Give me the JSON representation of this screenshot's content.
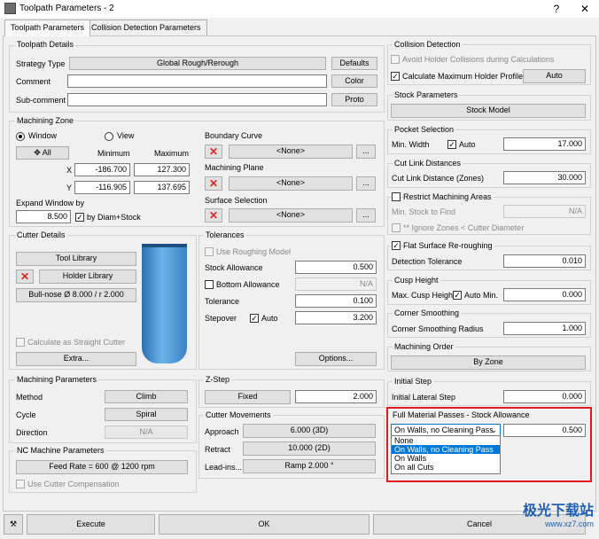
{
  "window": {
    "title": "Toolpath Parameters - 2",
    "help_label": "?",
    "close_label": "✕"
  },
  "tabs": [
    "Toolpath Parameters",
    "Collision Detection Parameters"
  ],
  "toolpath_details": {
    "group_title": "Toolpath Details",
    "strategy_type_label": "Strategy Type",
    "strategy_type_value": "Global Rough/Rerough",
    "defaults_label": "Defaults",
    "comment_label": "Comment",
    "comment_value": "",
    "color_label": "Color",
    "subcomment_label": "Sub-comment",
    "subcomment_value": "",
    "proto_label": "Proto"
  },
  "machining_zone": {
    "group_title": "Machining Zone",
    "window_label": "Window",
    "view_label": "View",
    "all_label": "All",
    "minimum_label": "Minimum",
    "maximum_label": "Maximum",
    "x_label": "X",
    "y_label": "Y",
    "x_min": "-186.700",
    "x_max": "127.300",
    "y_min": "-116.905",
    "y_max": "137.695",
    "expand_label": "Expand Window by",
    "expand_value": "8.500",
    "diam_stock_label": "by Diam+Stock",
    "boundary_label": "Boundary Curve",
    "boundary_value": "<None>",
    "plane_label": "Machining Plane",
    "plane_value": "<None>",
    "surface_label": "Surface Selection",
    "surface_value": "<None>",
    "ellipsis": "..."
  },
  "cutter_details": {
    "group_title": "Cutter Details",
    "tool_library_label": "Tool Library",
    "holder_library_label": "Holder Library",
    "tool_name": "Bull-nose Ø 8.000 / r 2.000",
    "straight_cutter_label": "Calculate as Straight Cutter",
    "extra_label": "Extra..."
  },
  "tolerances": {
    "group_title": "Tolerances",
    "roughing_model_label": "Use Roughing Model",
    "stock_allowance_label": "Stock Allowance",
    "stock_allowance_value": "0.500",
    "bottom_allowance_label": "Bottom Allowance",
    "bottom_allowance_value": "N/A",
    "tolerance_label": "Tolerance",
    "tolerance_value": "0.100",
    "stepover_label": "Stepover",
    "auto_label": "Auto",
    "stepover_value": "3.200",
    "options_label": "Options..."
  },
  "machining_parameters": {
    "group_title": "Machining Parameters",
    "method_label": "Method",
    "method_value": "Climb",
    "cycle_label": "Cycle",
    "cycle_value": "Spiral",
    "direction_label": "Direction",
    "direction_value": "N/A"
  },
  "nc_machine": {
    "group_title": "NC Machine Parameters",
    "feed_rate": "Feed Rate = 600 @ 1200 rpm",
    "cutter_comp_label": "Use Cutter Compensation"
  },
  "z_step": {
    "group_title": "Z-Step",
    "mode_value": "Fixed",
    "value": "2.000"
  },
  "cutter_movements": {
    "group_title": "Cutter Movements",
    "approach_label": "Approach",
    "approach_value": "6.000 (3D)",
    "retract_label": "Retract",
    "retract_value": "10.000 (2D)",
    "leadins_label": "Lead-ins...",
    "leadins_value": "Ramp 2.000 °"
  },
  "collision_detection": {
    "group_title": "Collision Detection",
    "avoid_holder_label": "Avoid Holder Collisions during Calculations",
    "max_holder_label": "Calculate Maximum Holder Profile",
    "auto_label": "Auto"
  },
  "stock_parameters": {
    "group_title": "Stock Parameters",
    "stock_model_label": "Stock Model"
  },
  "pocket_selection": {
    "group_title": "Pocket Selection",
    "min_width_label": "Min. Width",
    "auto_label": "Auto",
    "min_width_value": "17.000"
  },
  "cut_link": {
    "group_title": "Cut Link Distances",
    "zones_label": "Cut Link Distance (Zones)",
    "zones_value": "30.000"
  },
  "restrict": {
    "restrict_label": "Restrict Machining Areas",
    "min_stock_label": "Min. Stock to Find",
    "min_stock_value": "N/A",
    "ignore_label": "** Ignore Zones < Cutter Diameter"
  },
  "flat_surface": {
    "reroughing_label": "Flat Surface Re-roughing",
    "detection_label": "Detection Tolerance",
    "detection_value": "0.010"
  },
  "cusp_height": {
    "group_title": "Cusp Height",
    "max_label": "Max. Cusp Height",
    "auto_min_label": "Auto Min.",
    "max_value": "0.000"
  },
  "corner_smoothing": {
    "group_title": "Corner Smoothing",
    "radius_label": "Corner Smoothing Radius",
    "radius_value": "1.000"
  },
  "machining_order": {
    "group_title": "Machining Order",
    "value": "By Zone"
  },
  "initial_step": {
    "group_title": "Initial Step",
    "lateral_label": "Initial Lateral Step",
    "lateral_value": "0.000"
  },
  "full_material": {
    "group_title": "Full Material Passes - Stock Allowance",
    "selected_value": "On Walls, no Cleaning Pass",
    "value": "0.500",
    "options": [
      "None",
      "On Walls, no Cleaning Pass",
      "On Walls",
      "On all Cuts"
    ]
  },
  "bottom_bar": {
    "execute_label": "Execute",
    "ok_label": "OK",
    "cancel_label": "Cancel"
  },
  "watermark": {
    "text": "极光下载站",
    "url": "www.xz7.com"
  },
  "colors": {
    "accent": "#0078d7",
    "highlight_box": "#e0181f",
    "cutter_blue": "#3b82c4"
  }
}
